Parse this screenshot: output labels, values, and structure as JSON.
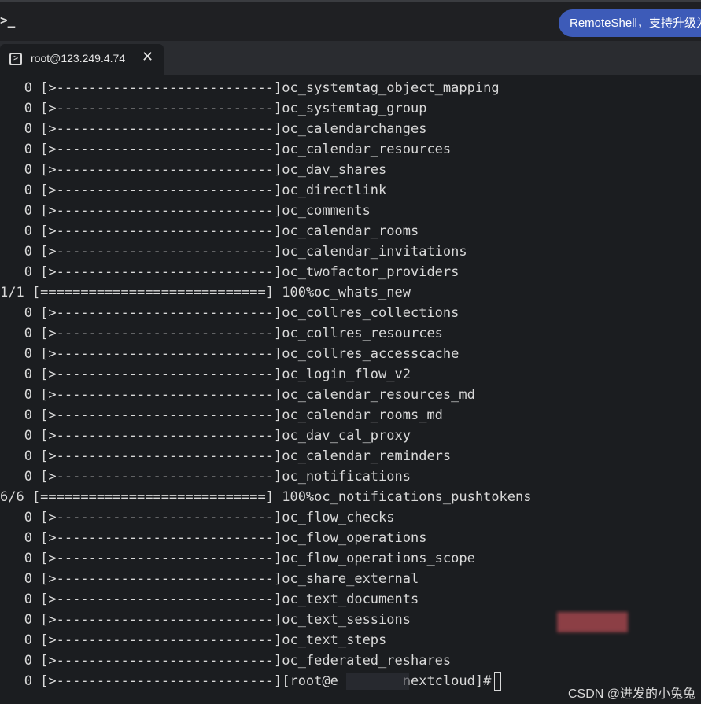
{
  "window": {
    "app_icon": ">_",
    "notice": "RemoteShell，支持升级为"
  },
  "tab": {
    "icon": "terminal-icon",
    "title": "root@123.249.4.74",
    "close_label": "✕"
  },
  "terminal": {
    "lines": [
      "   0 [>---------------------------]oc_systemtag_object_mapping",
      "   0 [>---------------------------]oc_systemtag_group",
      "   0 [>---------------------------]oc_calendarchanges",
      "   0 [>---------------------------]oc_calendar_resources",
      "   0 [>---------------------------]oc_dav_shares",
      "   0 [>---------------------------]oc_directlink",
      "   0 [>---------------------------]oc_comments",
      "   0 [>---------------------------]oc_calendar_rooms",
      "   0 [>---------------------------]oc_calendar_invitations",
      "   0 [>---------------------------]oc_twofactor_providers",
      "1/1 [============================] 100%oc_whats_new",
      "   0 [>---------------------------]oc_collres_collections",
      "   0 [>---------------------------]oc_collres_resources",
      "   0 [>---------------------------]oc_collres_accesscache",
      "   0 [>---------------------------]oc_login_flow_v2",
      "   0 [>---------------------------]oc_calendar_resources_md",
      "   0 [>---------------------------]oc_calendar_rooms_md",
      "   0 [>---------------------------]oc_dav_cal_proxy",
      "   0 [>---------------------------]oc_calendar_reminders",
      "   0 [>---------------------------]oc_notifications",
      "6/6 [============================] 100%oc_notifications_pushtokens",
      "   0 [>---------------------------]oc_flow_checks",
      "   0 [>---------------------------]oc_flow_operations",
      "   0 [>---------------------------]oc_flow_operations_scope",
      "   0 [>---------------------------]oc_share_external",
      "   0 [>---------------------------]oc_text_documents",
      "   0 [>---------------------------]oc_text_sessions",
      "   0 [>---------------------------]oc_text_steps",
      "   0 [>---------------------------]oc_federated_reshares"
    ],
    "prompt_line": "   0 [>---------------------------][root@e        nextcloud]#"
  },
  "watermark": "CSDN @进发的小兔兔"
}
